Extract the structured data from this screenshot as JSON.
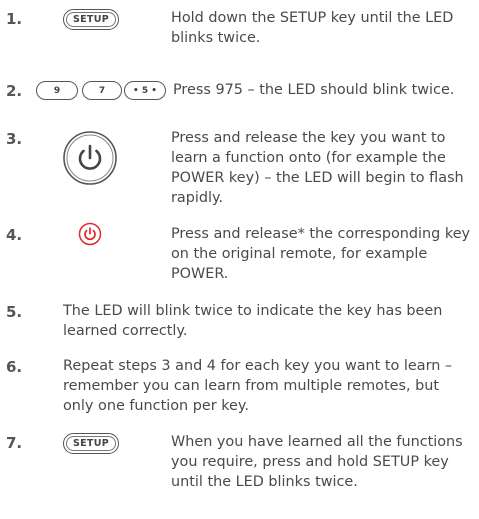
{
  "steps": [
    {
      "num": "1.",
      "key_label": "SETUP",
      "text": "Hold down the SETUP key until the LED blinks twice."
    },
    {
      "num": "2.",
      "digit_keys": [
        "9",
        "7",
        "• 5 •"
      ],
      "text": "Press 975 – the LED should blink twice."
    },
    {
      "num": "3.",
      "icon": "power-icon",
      "text": "Press and release the key you want to learn a function onto (for example the POWER key) – the LED will begin to flash rapidly."
    },
    {
      "num": "4.",
      "icon": "power-icon-red",
      "text": "Press and release* the corresponding key on the original remote, for example POWER."
    },
    {
      "num": "5.",
      "text": "The LED will blink twice to indicate the key has been learned correctly."
    },
    {
      "num": "6.",
      "text": "Repeat steps 3 and 4 for each key you want to learn – remember you can learn from multiple remotes, but only one function per key."
    },
    {
      "num": "7.",
      "key_label": "SETUP",
      "text": "When you have learned all the functions you require, press and hold SETUP key until the LED blinks twice."
    }
  ],
  "colors": {
    "text": "#4a4a4a",
    "power_red": "#e3262e"
  }
}
